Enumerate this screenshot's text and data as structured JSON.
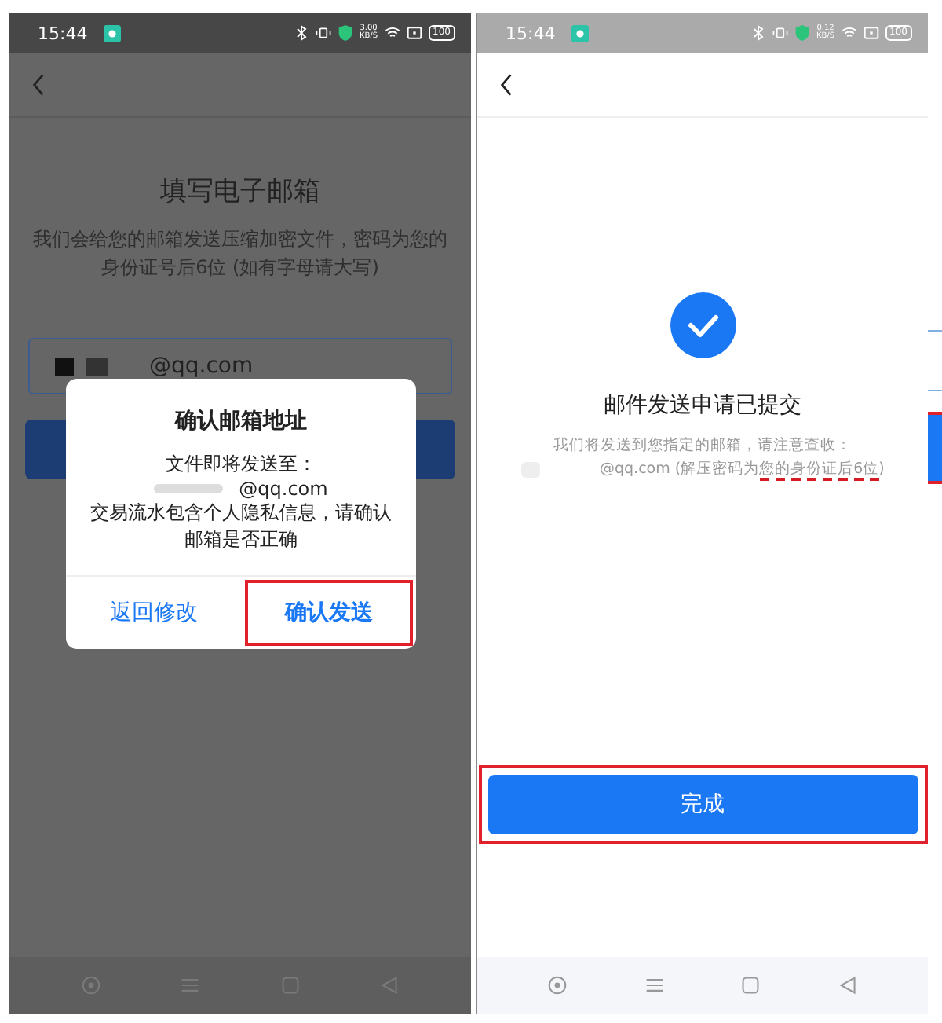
{
  "left_screen": {
    "status_bar": {
      "time": "15:44",
      "speed": "3.00",
      "speed_unit": "KB/S",
      "battery": "100"
    },
    "title": "填写电子邮箱",
    "subtitle": "我们会给您的邮箱发送压缩加密文件，密码为您的身份证号后6位 (如有字母请大写)",
    "email_field": {
      "value": "@qq.com"
    },
    "dialog": {
      "title": "确认邮箱地址",
      "line_1": "文件即将发送至：",
      "email": "@qq.com",
      "note": "交易流水包含个人隐私信息，请确认邮箱是否正确",
      "buttons": [
        {
          "label": "返回修改",
          "highlighted": false
        },
        {
          "label": "确认发送",
          "highlighted": true
        }
      ]
    }
  },
  "right_screen": {
    "status_bar": {
      "time": "15:44",
      "speed": "0.12",
      "speed_unit": "KB/S",
      "battery": "100"
    },
    "title": "邮件发送申请已提交",
    "line_1": "我们将发送到您指定的邮箱，请注意查收：",
    "line_2": [
      {
        "text": "@qq.com (解压密码为",
        "marked": false
      },
      {
        "text": "您的身份证后6位",
        "marked": true
      },
      {
        "text": ")",
        "marked": false
      }
    ],
    "done_button": {
      "label": "完成",
      "highlighted": true
    }
  }
}
